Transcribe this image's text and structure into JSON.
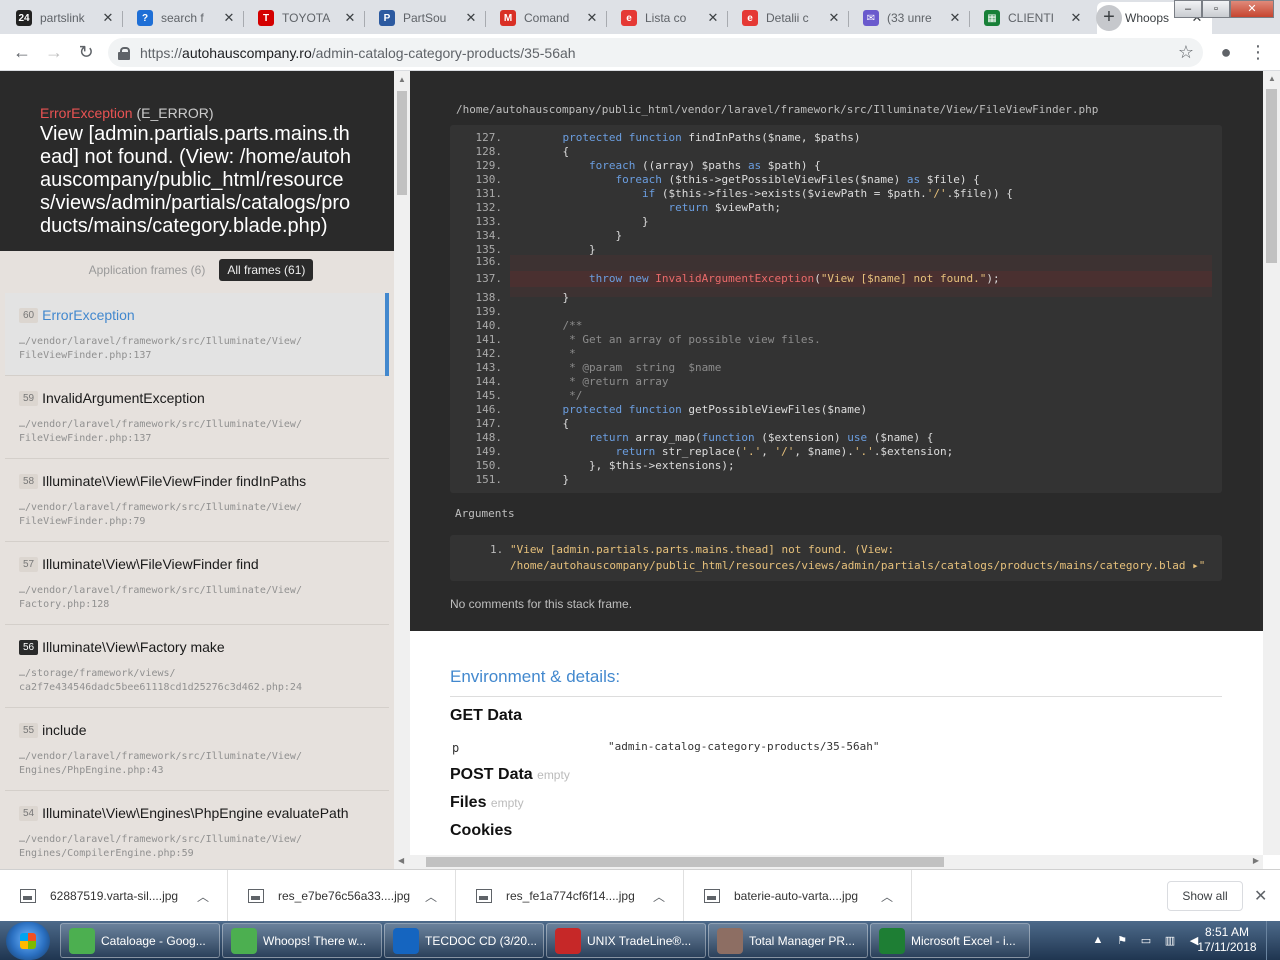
{
  "browser": {
    "tabs": [
      {
        "title": "partslink",
        "icon": "partslink-icon",
        "color": "#222222",
        "glyph": "24"
      },
      {
        "title": "search f",
        "icon": "search-site-icon",
        "color": "#1e6fd6",
        "glyph": "?"
      },
      {
        "title": "TOYOTA",
        "icon": "toyota-icon",
        "color": "#d40000",
        "glyph": "T"
      },
      {
        "title": "PartSou",
        "icon": "partsouq-icon",
        "color": "#2c5aa0",
        "glyph": "P"
      },
      {
        "title": "Comand",
        "icon": "gmail-icon",
        "color": "#d93025",
        "glyph": "M"
      },
      {
        "title": "Lista co",
        "icon": "site-e-icon",
        "color": "#e53935",
        "glyph": "e"
      },
      {
        "title": "Detalii c",
        "icon": "site-e-icon",
        "color": "#e53935",
        "glyph": "e"
      },
      {
        "title": "(33 unre",
        "icon": "mail-icon",
        "color": "#6a5acd",
        "glyph": "✉"
      },
      {
        "title": "CLIENTI",
        "icon": "sheets-icon",
        "color": "#188038",
        "glyph": "▦"
      },
      {
        "title": "Whoops",
        "icon": "page-icon",
        "color": "#ffffff",
        "glyph": ""
      }
    ],
    "url": {
      "protocol": "https://",
      "host": "autohauscompany.ro",
      "path": "/admin-catalog-category-products/35-56ah"
    }
  },
  "error": {
    "type": "ErrorException",
    "level": "(E_ERROR)",
    "message": "View [admin.partials.parts.mains.thead] not found. (View: /home/autohauscompany/public_html/resources/views/admin/partials/catalogs/products/mains/category.blade.php)"
  },
  "frame_tabs": {
    "application": "Application frames (6)",
    "all": "All frames (61)"
  },
  "frames": [
    {
      "num": "60",
      "class": "ErrorException",
      "file1": "…/vendor/laravel/framework/src/Illuminate/View/",
      "file2": "FileViewFinder.php",
      "line": ":137"
    },
    {
      "num": "59",
      "class": "InvalidArgumentException",
      "file1": "…/vendor/laravel/framework/src/Illuminate/View/",
      "file2": "FileViewFinder.php",
      "line": ":137"
    },
    {
      "num": "58",
      "class": "Illuminate\\View\\FileViewFinder findInPaths",
      "file1": "…/vendor/laravel/framework/src/Illuminate/View/",
      "file2": "FileViewFinder.php",
      "line": ":79"
    },
    {
      "num": "57",
      "class": "Illuminate\\View\\FileViewFinder find",
      "file1": "…/vendor/laravel/framework/src/Illuminate/View/",
      "file2": "Factory.php",
      "line": ":128"
    },
    {
      "num": "56",
      "class": "Illuminate\\View\\Factory make",
      "file1": "…/storage/framework/views/",
      "file2": "ca2f7e434546dadc5bee61118cd1d25276c3d462.php",
      "line": ":24"
    },
    {
      "num": "55",
      "class": "include",
      "file1": "…/vendor/laravel/framework/src/Illuminate/View/",
      "file2": "Engines/PhpEngine.php",
      "line": ":43"
    },
    {
      "num": "54",
      "class": "Illuminate\\View\\Engines\\PhpEngine evaluatePath",
      "file1": "…/vendor/laravel/framework/src/Illuminate/View/",
      "file2": "Engines/CompilerEngine.php",
      "line": ":59"
    }
  ],
  "code": {
    "file": "/home/autohauscompany/public_html/vendor/laravel/framework/src/Illuminate/View/FileViewFinder.php",
    "lines": [
      {
        "n": "127.",
        "t": "    protected function findInPaths($name, $paths)"
      },
      {
        "n": "128.",
        "t": "    {"
      },
      {
        "n": "129.",
        "t": "        foreach ((array) $paths as $path) {"
      },
      {
        "n": "130.",
        "t": "            foreach ($this->getPossibleViewFiles($name) as $file) {"
      },
      {
        "n": "131.",
        "t": "                if ($this->files->exists($viewPath = $path.'/'.$file)) {"
      },
      {
        "n": "132.",
        "t": "                    return $viewPath;"
      },
      {
        "n": "133.",
        "t": "                }"
      },
      {
        "n": "134.",
        "t": "            }"
      },
      {
        "n": "135.",
        "t": "        }"
      },
      {
        "n": "136.",
        "t": ""
      },
      {
        "n": "137.",
        "t": "        throw new InvalidArgumentException(\"View [$name] not found.\");"
      },
      {
        "n": "138.",
        "t": "    }"
      },
      {
        "n": "139.",
        "t": ""
      },
      {
        "n": "140.",
        "t": "    /**"
      },
      {
        "n": "141.",
        "t": "     * Get an array of possible view files."
      },
      {
        "n": "142.",
        "t": "     *"
      },
      {
        "n": "143.",
        "t": "     * @param  string  $name"
      },
      {
        "n": "144.",
        "t": "     * @return array"
      },
      {
        "n": "145.",
        "t": "     */"
      },
      {
        "n": "146.",
        "t": "    protected function getPossibleViewFiles($name)"
      },
      {
        "n": "147.",
        "t": "    {"
      },
      {
        "n": "148.",
        "t": "        return array_map(function ($extension) use ($name) {"
      },
      {
        "n": "149.",
        "t": "            return str_replace('.', '/', $name).'.'.$extension;"
      },
      {
        "n": "150.",
        "t": "        }, $this->extensions);"
      },
      {
        "n": "151.",
        "t": "    }"
      }
    ]
  },
  "arguments": {
    "label": "Arguments",
    "num": "1.",
    "line1": "\"View [admin.partials.parts.mains.thead] not found. (View:",
    "line2": "/home/autohauscompany/public_html/resources/views/admin/partials/catalogs/products/mains/category.blad ▸\"",
    "no_comments": "No comments for this stack frame."
  },
  "details": {
    "title": "Environment & details:",
    "get": "GET Data",
    "get_key": "p",
    "get_value": "\"admin-catalog-category-products/35-56ah\"",
    "post": "POST Data",
    "files": "Files",
    "cookies": "Cookies",
    "empty": "empty"
  },
  "downloads": [
    {
      "name": "62887519.varta-sil....jpg"
    },
    {
      "name": "res_e7be76c56a33....jpg"
    },
    {
      "name": "res_fe1a774cf6f14....jpg"
    },
    {
      "name": "baterie-auto-varta....jpg"
    }
  ],
  "shelf": {
    "show_all": "Show all"
  },
  "taskbar": {
    "items": [
      {
        "label": "Cataloage - Goog...",
        "icon": "chrome-icon",
        "color": "#4caf50"
      },
      {
        "label": "Whoops! There w...",
        "icon": "chrome-icon",
        "color": "#4caf50"
      },
      {
        "label": "TECDOC CD (3/20...",
        "icon": "tecdoc-icon",
        "color": "#1565c0"
      },
      {
        "label": "UNIX TradeLine®...",
        "icon": "unix-icon",
        "color": "#c62828"
      },
      {
        "label": "Total Manager PR...",
        "icon": "total-manager-icon",
        "color": "#8d6e63"
      },
      {
        "label": "Microsoft Excel - i...",
        "icon": "excel-icon",
        "color": "#1e7e34"
      }
    ],
    "time": "8:51 AM",
    "date": "17/11/2018"
  }
}
